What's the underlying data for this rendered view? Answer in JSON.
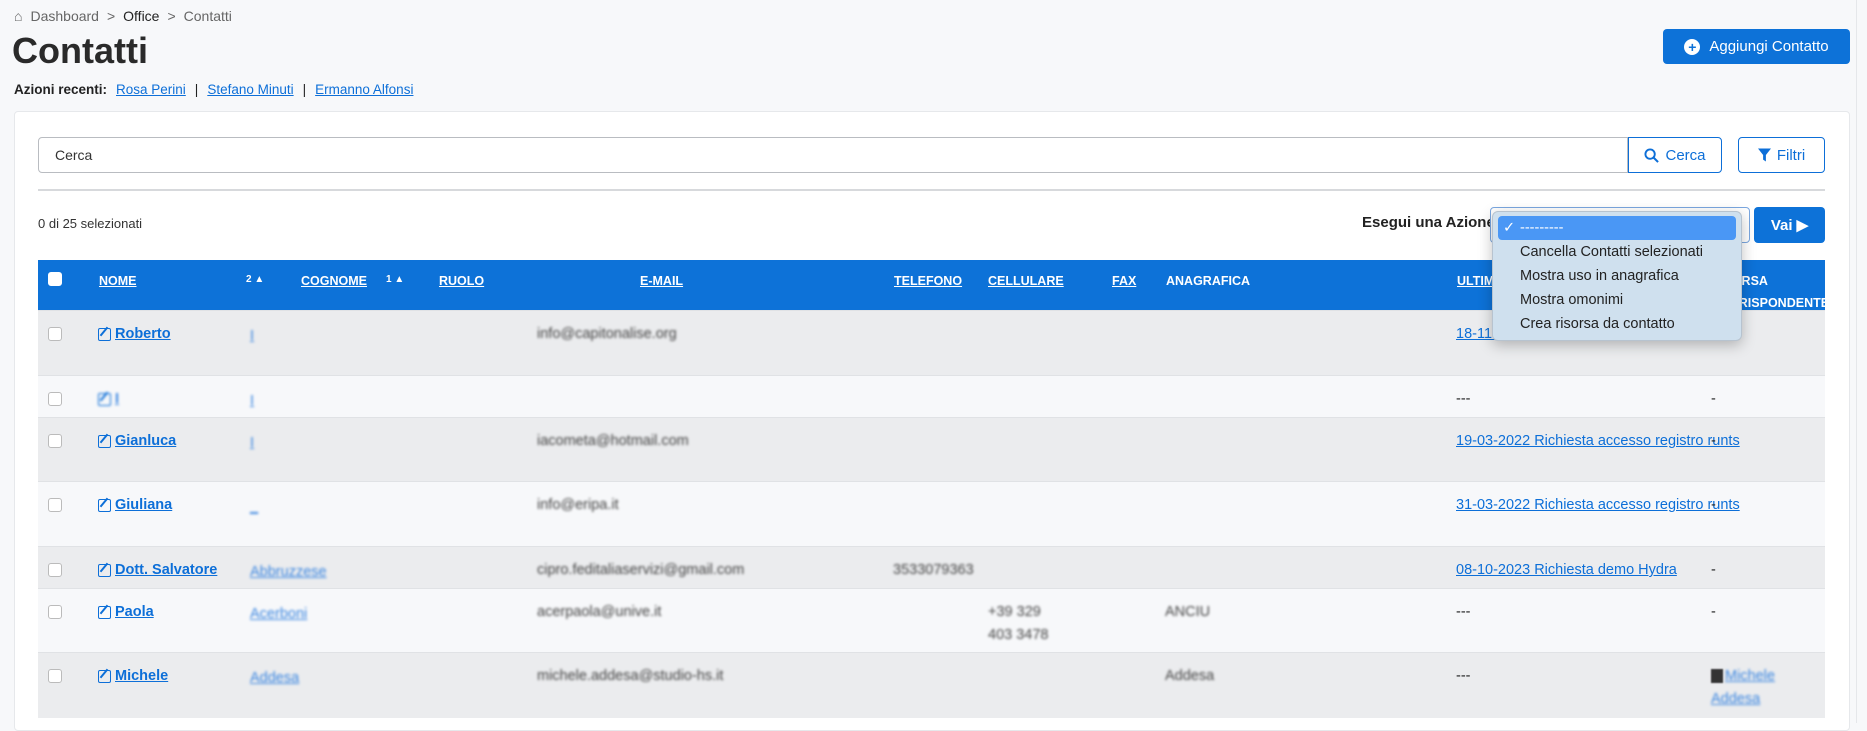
{
  "breadcrumb": [
    {
      "label": "Dashboard",
      "icon": "home-icon"
    },
    {
      "label": "Office"
    },
    {
      "label": "Contatti"
    }
  ],
  "breadcrumb_sep": ">",
  "title": "Contatti",
  "recent": {
    "label": "Azioni recenti:",
    "items": [
      "Rosa Perini",
      "Stefano Minuti",
      "Ermanno Alfonsi"
    ],
    "sep": "|"
  },
  "add_button": "Aggiungi Contatto",
  "search": {
    "placeholder": "Cerca",
    "button": "Cerca",
    "filters": "Filtri"
  },
  "selection": "0 di 25 selezionati",
  "action": {
    "label": "Esegui una Azione",
    "go": "Vai",
    "options": [
      "---------",
      "Cancella Contatti selezionati",
      "Mostra uso in anagrafica",
      "Mostra omonimi",
      "Crea risorsa da contatto"
    ],
    "selected": "---------"
  },
  "columns": {
    "nome": "NOME",
    "nome_sort": "2 ▲",
    "cognome": "COGNOME",
    "cognome_sort": "1 ▲",
    "ruolo": "RUOLO",
    "email": "E-MAIL",
    "telefono": "TELEFONO",
    "cellulare": "CELLULARE",
    "fax": "FAX",
    "anagrafica": "ANAGRAFICA",
    "ultima": "ULTIMA OPPORTUNITÀ",
    "last": "RISORSA CORRISPONDENTE"
  },
  "rows": [
    {
      "nome": "Roberto",
      "cognome": "I",
      "email": "info@capitonalise.org",
      "ultima": "18-11-2021 Richiesta accesso registro runts",
      "last": ""
    },
    {
      "nome": "I",
      "cognome": "I",
      "email": "",
      "ultima": "---",
      "last": "-"
    },
    {
      "nome": "Gianluca",
      "cognome": "I",
      "email": "iacometa@hotmail.com",
      "ultima": "19-03-2022 Richiesta accesso registro runts",
      "last": "-"
    },
    {
      "nome": "Giuliana",
      "cognome": "_",
      "email": "info@eripa.it",
      "ultima": "31-03-2022 Richiesta accesso registro runts",
      "last": "-"
    },
    {
      "nome": "Dott. Salvatore",
      "cognome": "Abbruzzese",
      "email": "cipro.feditaliaservizi@gmail.com",
      "telefono": "3533079363",
      "ultima": "08-10-2023 Richiesta demo Hydra",
      "last": "-"
    },
    {
      "nome": "Paola",
      "cognome": "Acerboni",
      "email": "acerpaola@unive.it",
      "cellulare": "+39 329 403 3478",
      "anagrafica": "ANCIU",
      "ultima": "---",
      "last": "-"
    },
    {
      "nome": "Michele",
      "cognome": "Addesa",
      "email": "michele.addesa@studio-hs.it",
      "anagrafica": "Addesa",
      "ultima": "---",
      "last": "Michele Addesa"
    }
  ],
  "colors": {
    "primary": "#0d72d8",
    "row_odd": "#ebecee",
    "row_even": "#f7f8fa",
    "dropdown_highlight": "#4a97f5"
  }
}
